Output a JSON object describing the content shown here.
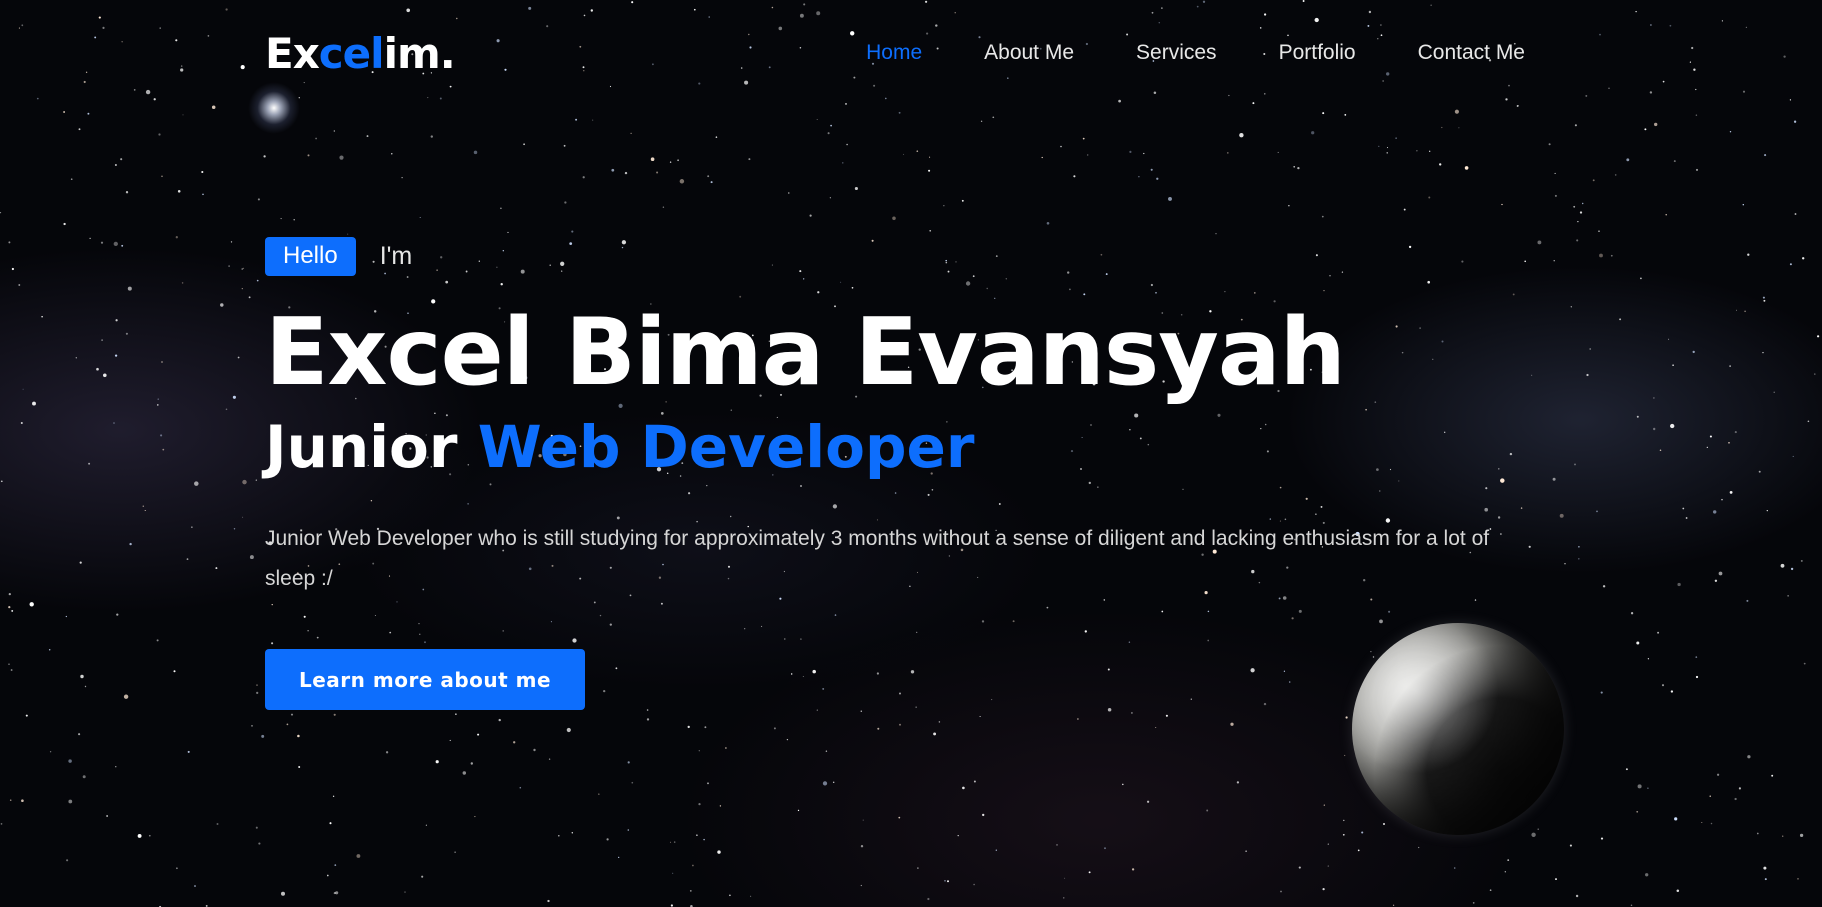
{
  "brand": {
    "logo_part1": "Ex",
    "logo_part2": "cel",
    "logo_part3": "im.",
    "accent_color": "#0d6efd"
  },
  "nav": {
    "items": [
      {
        "label": "Home",
        "active": true
      },
      {
        "label": "About Me",
        "active": false
      },
      {
        "label": "Services",
        "active": false
      },
      {
        "label": "Portfolio",
        "active": false
      },
      {
        "label": "Contact Me",
        "active": false
      }
    ]
  },
  "hero": {
    "badge": "Hello",
    "greeting_suffix": "I'm",
    "name": "Excel Bima Evansyah",
    "role_prefix": "Junior",
    "role_highlight": "Web Developer",
    "description": "Junior Web Developer who is still studying for approximately 3 months without a sense of diligent and lacking enthusiasm for a lot of sleep :/",
    "cta_label": "Learn more about me"
  },
  "background": {
    "theme": "starry-night-sky",
    "decorations": [
      "bright-star",
      "moon"
    ]
  }
}
